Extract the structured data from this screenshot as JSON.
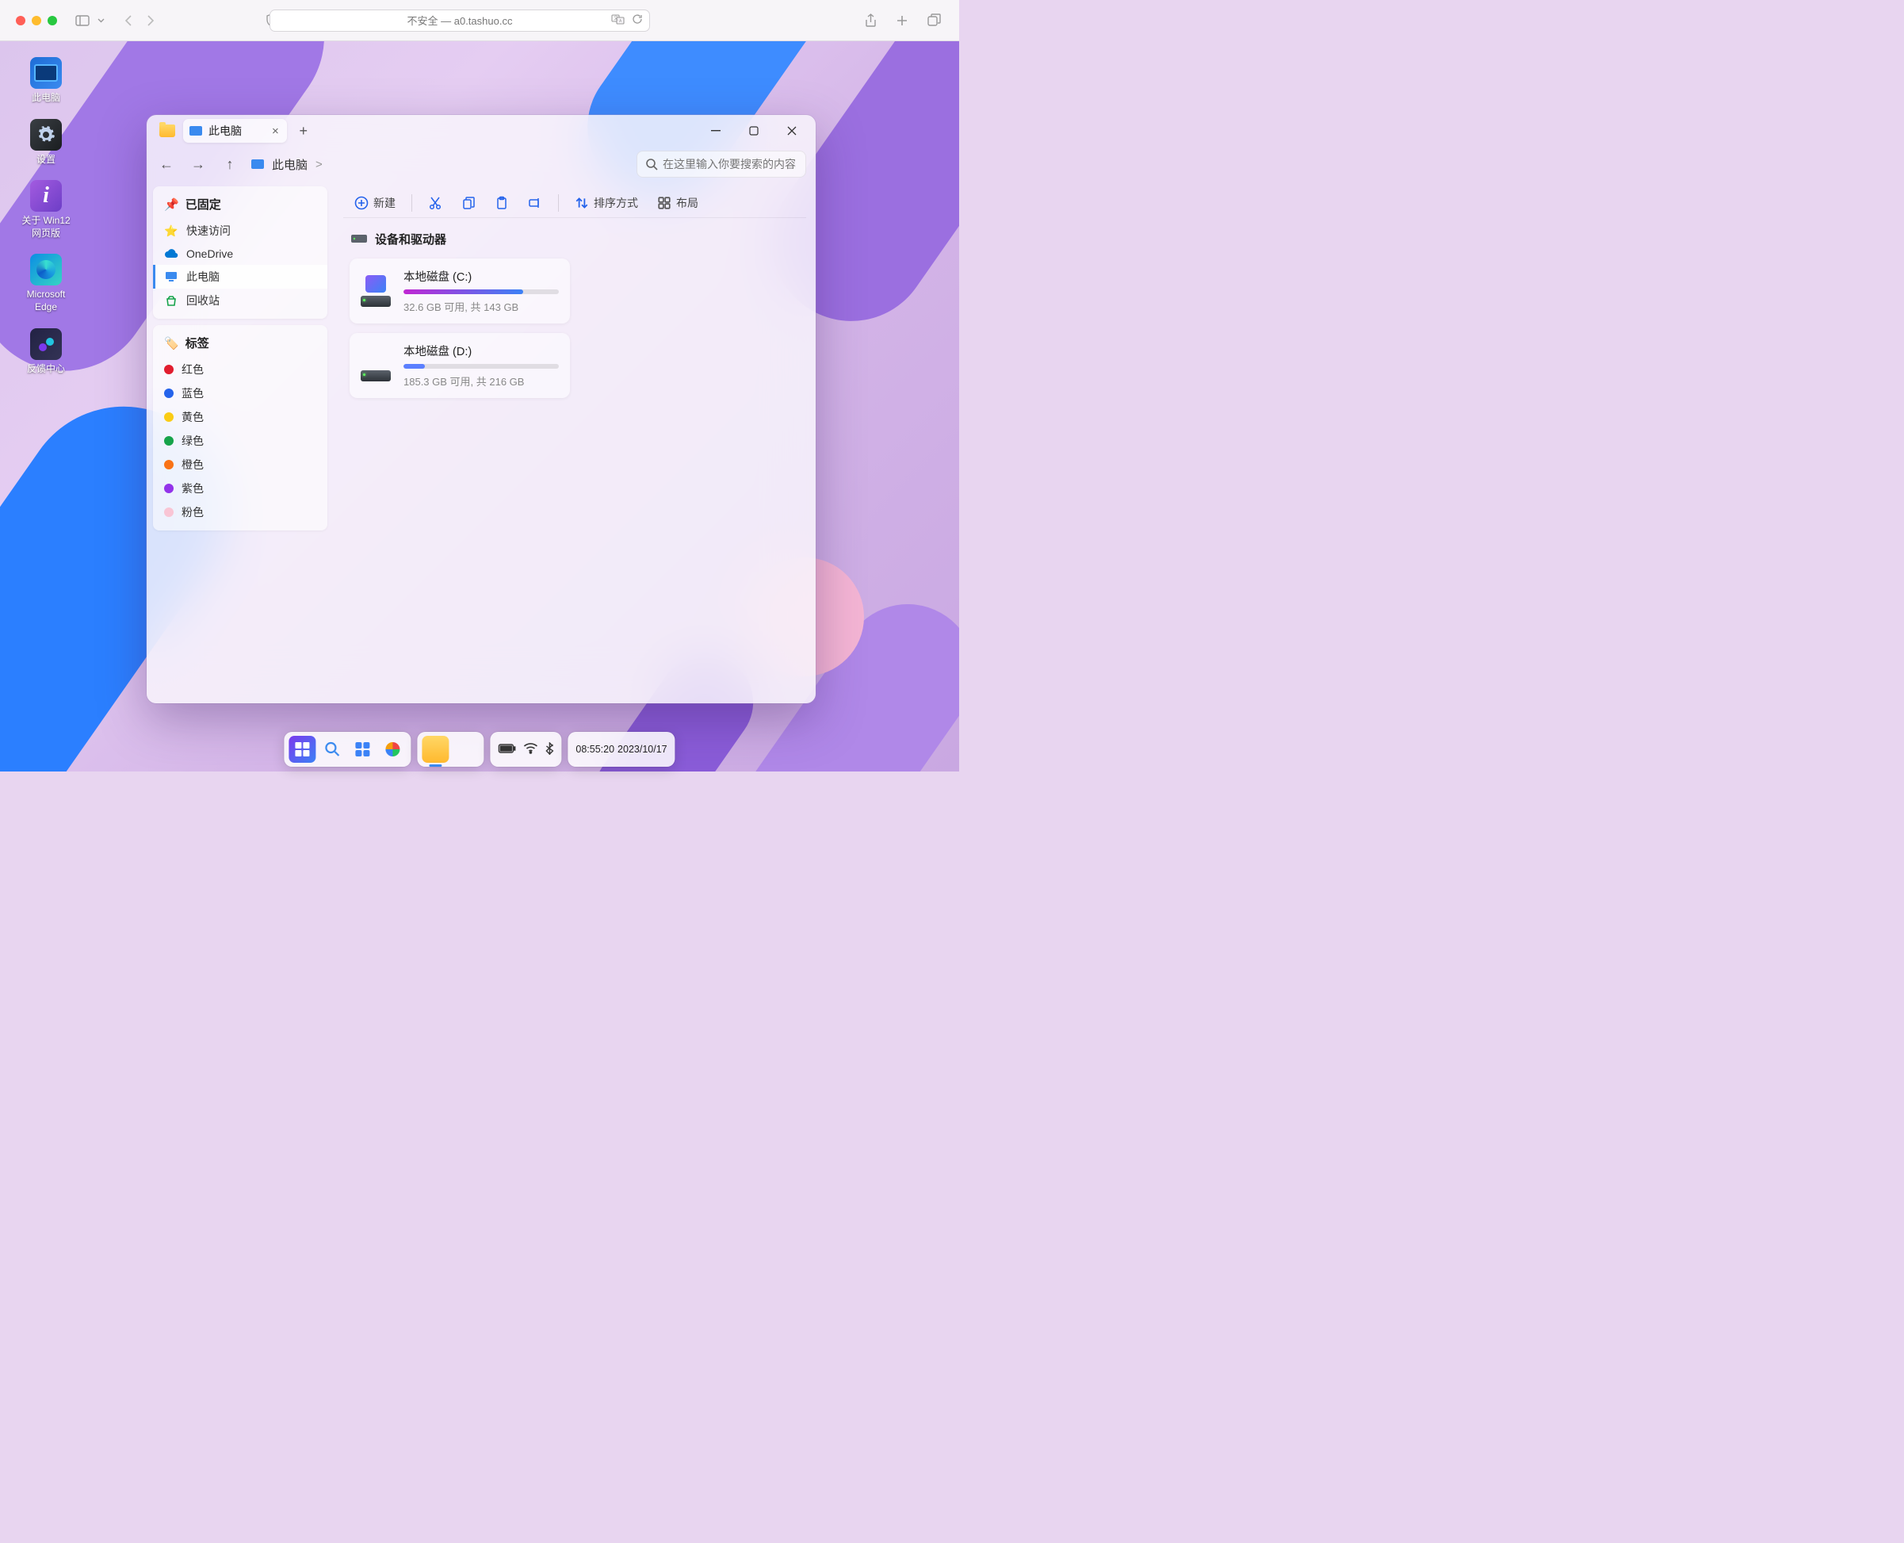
{
  "safari": {
    "address": "不安全 — a0.tashuo.cc"
  },
  "desktop": {
    "icons": {
      "pc": "此电脑",
      "settings": "设置",
      "about": "关于 Win12 网页版",
      "edge": "Microsoft Edge",
      "feedback": "反馈中心"
    }
  },
  "explorer": {
    "tab_title": "此电脑",
    "breadcrumb": "此电脑",
    "breadcrumb_sep": ">",
    "search_placeholder": "在这里输入你要搜索的内容",
    "sidebar": {
      "pinned_title": "已固定",
      "pinned": {
        "quick": "快速访问",
        "onedrive": "OneDrive",
        "pc": "此电脑",
        "recycle": "回收站"
      },
      "tags_title": "标签",
      "tags": [
        {
          "label": "红色",
          "color": "#e11d2e"
        },
        {
          "label": "蓝色",
          "color": "#2563eb"
        },
        {
          "label": "黄色",
          "color": "#facc15"
        },
        {
          "label": "绿色",
          "color": "#16a34a"
        },
        {
          "label": "橙色",
          "color": "#f97316"
        },
        {
          "label": "紫色",
          "color": "#9333ea"
        },
        {
          "label": "粉色",
          "color": "#f9c5d5"
        }
      ]
    },
    "toolbar": {
      "new": "新建",
      "sort": "排序方式",
      "layout": "布局"
    },
    "section": "设备和驱动器",
    "drives": [
      {
        "name": "本地磁盘 (C:)",
        "stats": "32.6 GB 可用, 共 143 GB",
        "used_pct": 77,
        "fill": "linear-gradient(90deg,#c026d3,#3b82f6)",
        "show_app": true
      },
      {
        "name": "本地磁盘 (D:)",
        "stats": "185.3 GB 可用, 共 216 GB",
        "used_pct": 14,
        "fill": "#5b7fff",
        "show_app": false
      }
    ]
  },
  "taskbar": {
    "time": "08:55:20",
    "date": "2023/10/17"
  }
}
